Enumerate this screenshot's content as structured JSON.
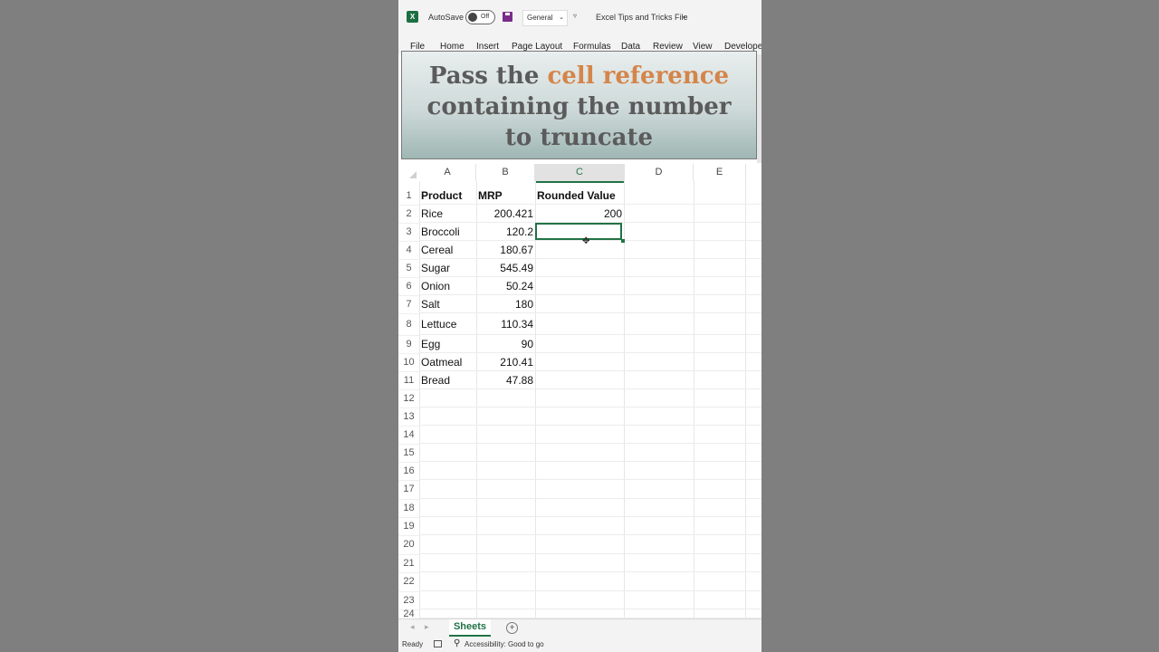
{
  "titlebar": {
    "autosave_label": "AutoSave",
    "autosave_state": "Off",
    "number_format": "General",
    "file_title": "Excel Tips and Tricks File"
  },
  "ribbon_tabs": [
    "File",
    "Home",
    "Insert",
    "Page Layout",
    "Formulas",
    "Data",
    "Review",
    "View",
    "Develope"
  ],
  "active_tab": "Home",
  "caption": {
    "line1_pre": "Pass the ",
    "line1_highlight": "cell reference",
    "line2": "containing the number",
    "line3": "to truncate"
  },
  "columns": [
    "A",
    "B",
    "C",
    "D",
    "E"
  ],
  "selected_column": "C",
  "rows": [
    {
      "num": "1",
      "a": "Product",
      "b": "MRP",
      "c": "Rounded Value"
    },
    {
      "num": "2",
      "a": "Rice",
      "b": "200.421",
      "c": "200"
    },
    {
      "num": "3",
      "a": "Broccoli",
      "b": "120.2",
      "c": ""
    },
    {
      "num": "4",
      "a": "Cereal",
      "b": "180.67",
      "c": ""
    },
    {
      "num": "5",
      "a": "Sugar",
      "b": "545.49",
      "c": ""
    },
    {
      "num": "6",
      "a": "Onion",
      "b": "50.24",
      "c": ""
    },
    {
      "num": "7",
      "a": "Salt",
      "b": "180",
      "c": ""
    },
    {
      "num": "8",
      "a": "Lettuce",
      "b": "110.34",
      "c": ""
    },
    {
      "num": "9",
      "a": "Egg",
      "b": "90",
      "c": ""
    },
    {
      "num": "10",
      "a": "Oatmeal",
      "b": "210.41",
      "c": ""
    },
    {
      "num": "11",
      "a": "Bread",
      "b": "47.88",
      "c": ""
    },
    {
      "num": "12",
      "a": "",
      "b": "",
      "c": ""
    },
    {
      "num": "13",
      "a": "",
      "b": "",
      "c": ""
    },
    {
      "num": "14",
      "a": "",
      "b": "",
      "c": ""
    },
    {
      "num": "15",
      "a": "",
      "b": "",
      "c": ""
    },
    {
      "num": "16",
      "a": "",
      "b": "",
      "c": ""
    },
    {
      "num": "17",
      "a": "",
      "b": "",
      "c": ""
    },
    {
      "num": "18",
      "a": "",
      "b": "",
      "c": ""
    },
    {
      "num": "19",
      "a": "",
      "b": "",
      "c": ""
    },
    {
      "num": "20",
      "a": "",
      "b": "",
      "c": ""
    },
    {
      "num": "21",
      "a": "",
      "b": "",
      "c": ""
    },
    {
      "num": "22",
      "a": "",
      "b": "",
      "c": ""
    },
    {
      "num": "23",
      "a": "",
      "b": "",
      "c": ""
    },
    {
      "num": "24",
      "a": "",
      "b": "",
      "c": ""
    }
  ],
  "selected_cell": "C3",
  "sheet_tab": "Sheets",
  "status": {
    "ready": "Ready",
    "accessibility": "Accessibility: Good to go"
  },
  "colors": {
    "accent": "#217346",
    "caption_highlight": "#d4854a",
    "background": "#7f7f7f"
  },
  "icons": [
    "excel-logo-icon",
    "save-icon",
    "customize-qat-icon",
    "chevron-down-icon",
    "add-sheet-icon",
    "accessibility-icon",
    "cell-mode-icon",
    "move-cursor-icon"
  ]
}
